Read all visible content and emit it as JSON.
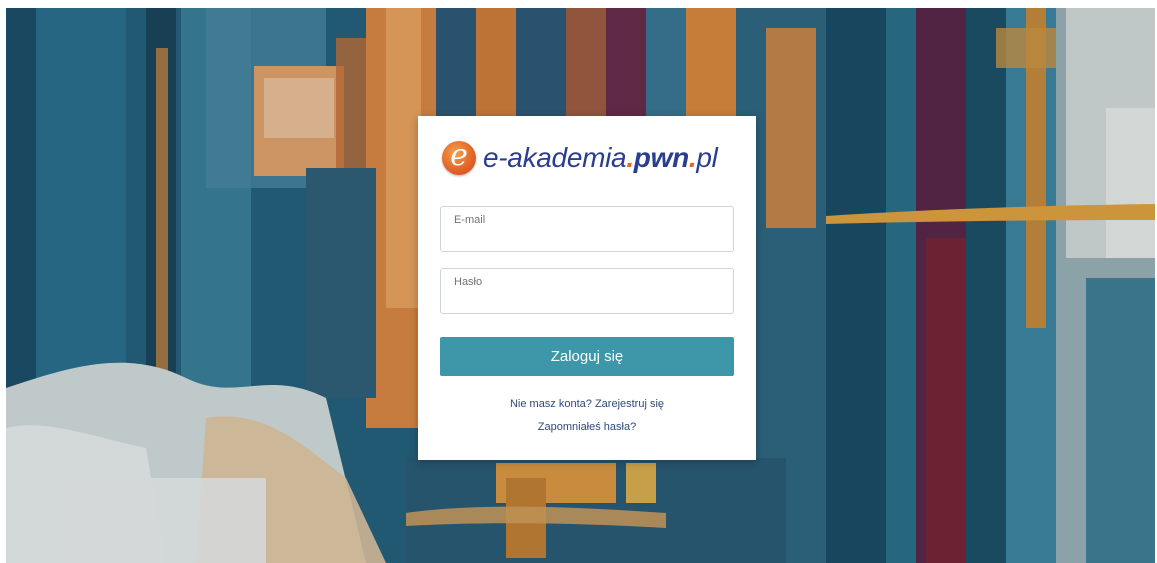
{
  "logo": {
    "badge_letter": "e",
    "text_part1": "e-akademia",
    "dot1": ".",
    "text_part2": "pwn",
    "dot2": ".",
    "text_part3": "pl"
  },
  "form": {
    "email_label": "E-mail",
    "email_value": "",
    "password_label": "Hasło",
    "password_value": "",
    "login_button_label": "Zaloguj się",
    "register_link": "Nie masz konta? Zarejestruj się",
    "forgot_link": "Zapomniałeś hasła?"
  },
  "colors": {
    "button_bg": "#3d97a9",
    "logo_blue": "#2a3e8f",
    "logo_orange": "#e4662a",
    "link": "#2f4a78"
  },
  "icons": {
    "logo_badge": "e-logo-icon"
  }
}
